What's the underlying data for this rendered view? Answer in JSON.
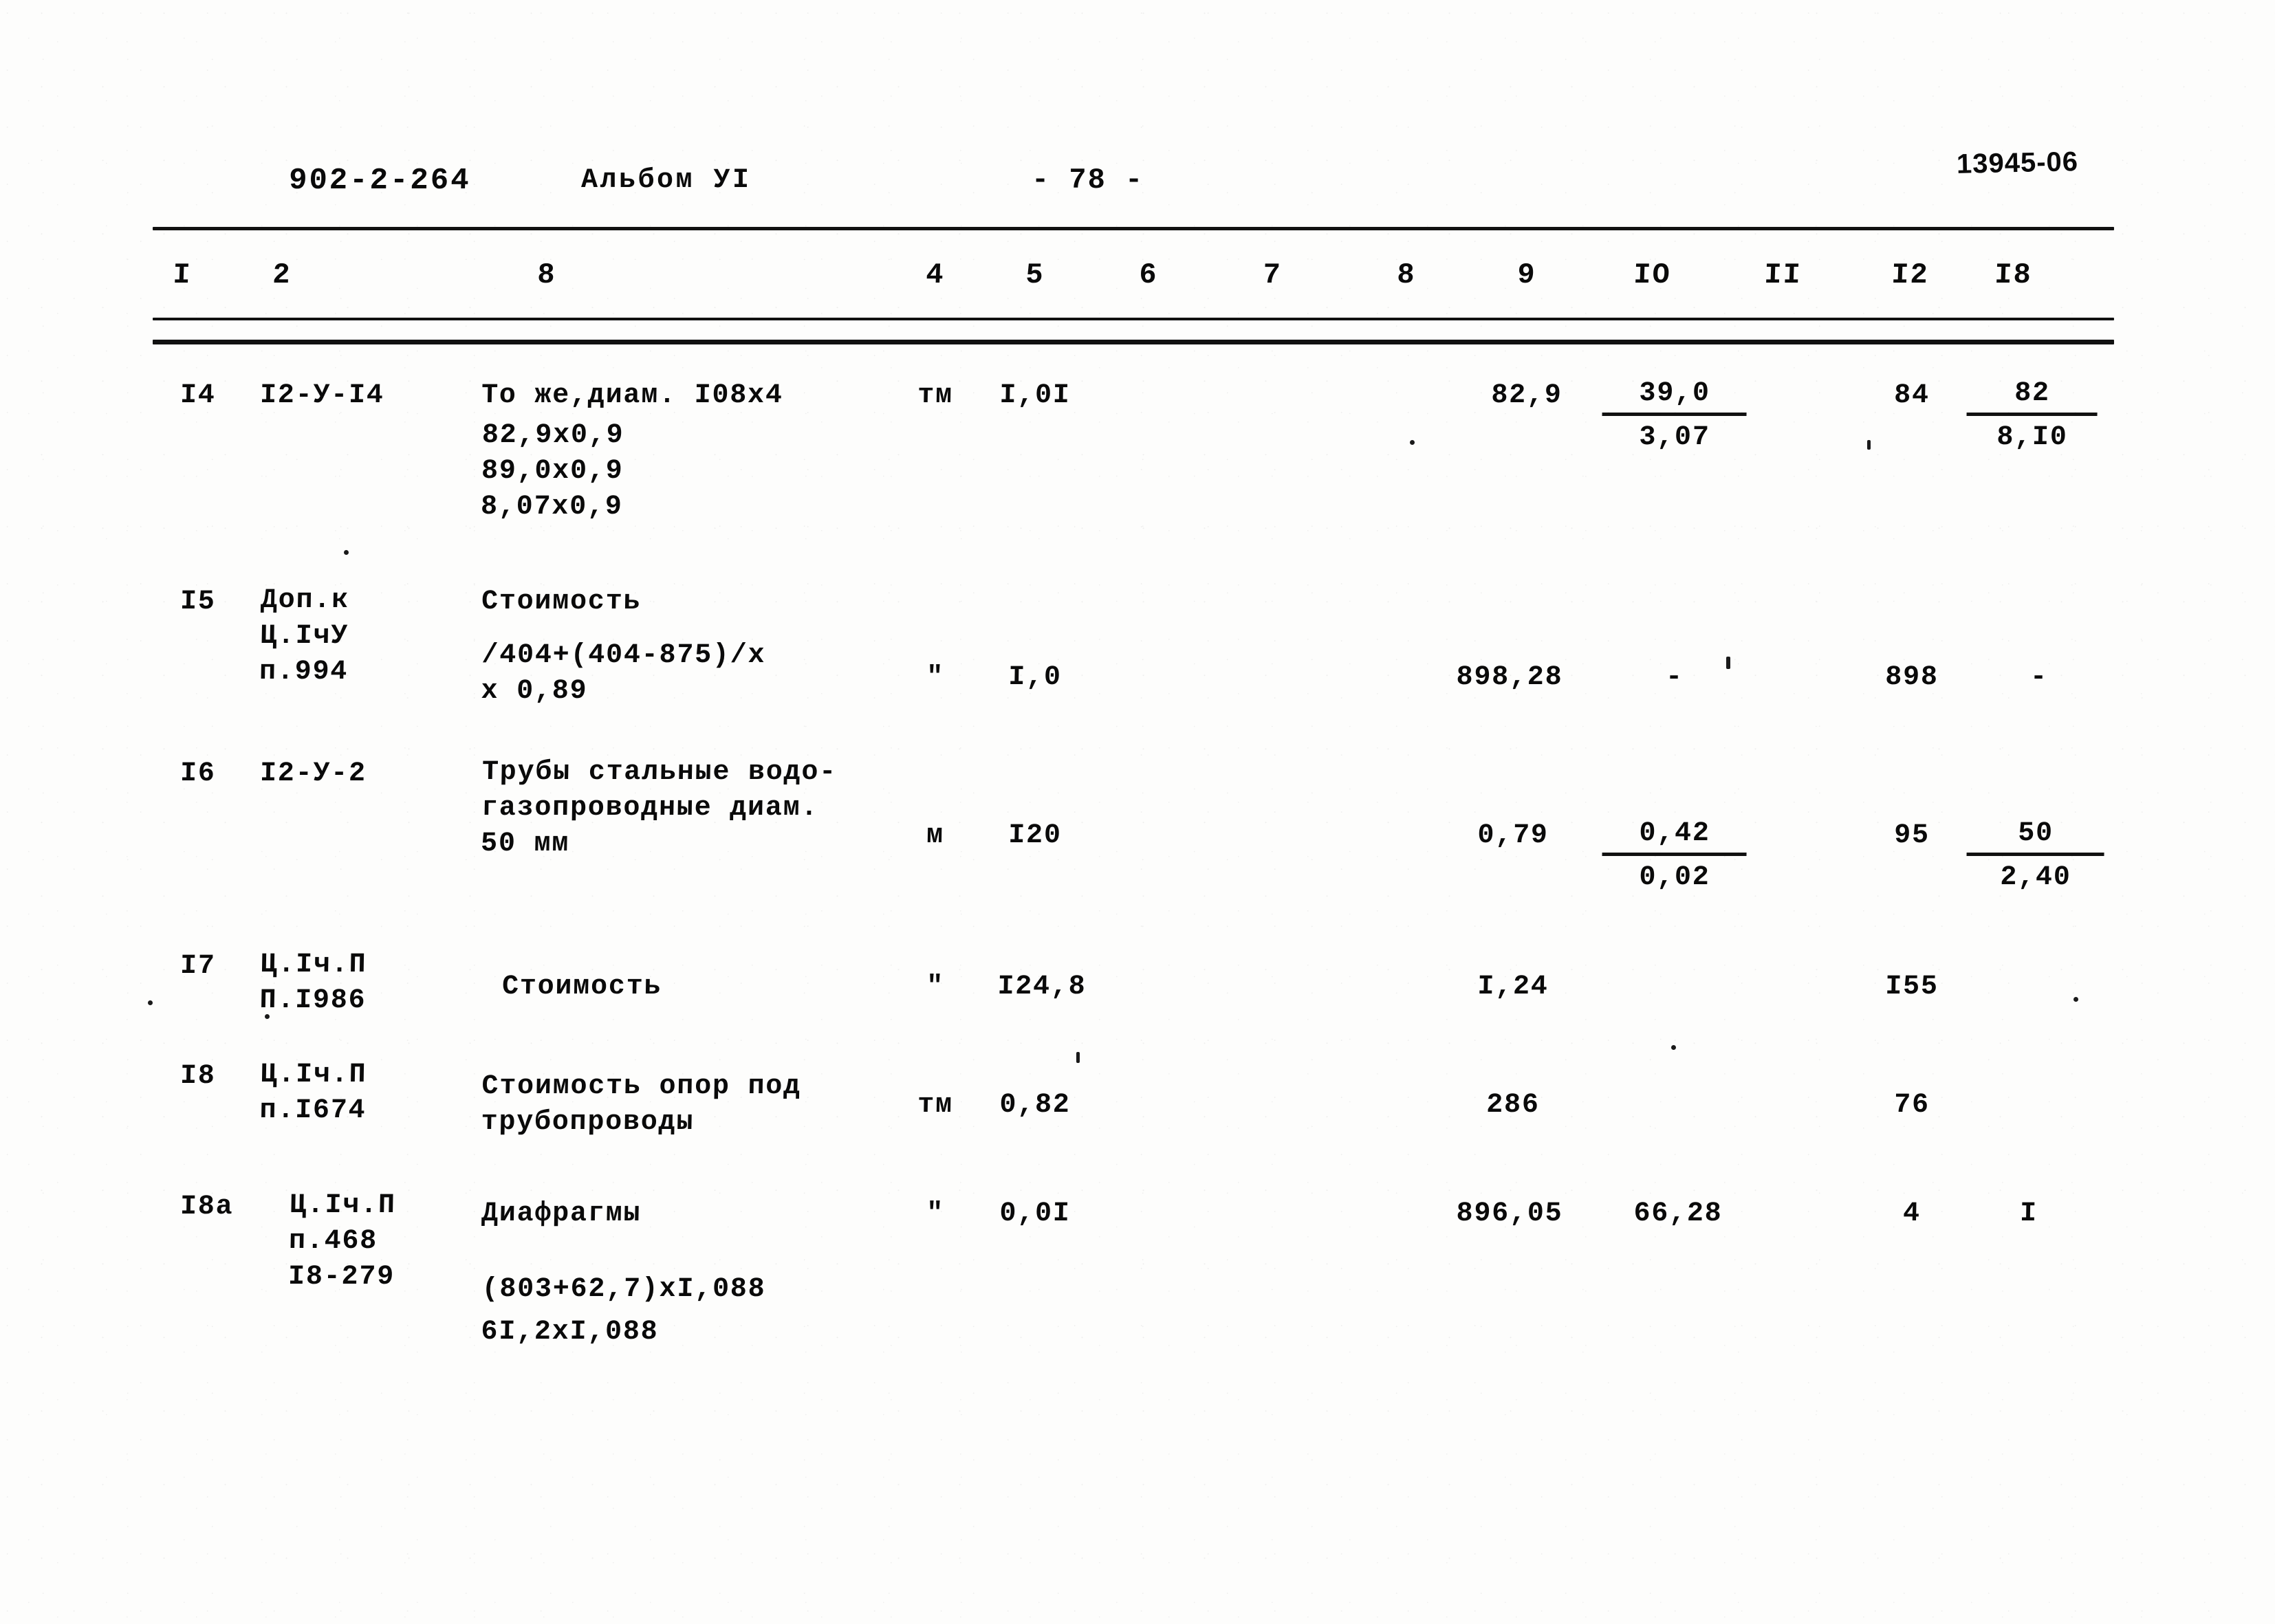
{
  "header": {
    "project_code": "902-2-264",
    "album": "Альбом УI",
    "page_number": "- 78 -",
    "archive_stamp": "13945-06"
  },
  "table": {
    "column_headers": [
      "I",
      "2",
      "8",
      "4",
      "5",
      "6",
      "7",
      "8",
      "9",
      "IO",
      "II",
      "I2",
      "I8"
    ],
    "rows": [
      {
        "no": "I4",
        "code": "I2-У-I4",
        "description": "То же,диам. I08х4",
        "description_lines": "82,9х0,9\n89,0х0,9\n8,07х0,9",
        "unit": "тм",
        "qty": "I,0I",
        "col6": "",
        "col7": "",
        "col8": "",
        "col9": "82,9",
        "col10_top": "39,0",
        "col10_bot": "3,07",
        "col11": "",
        "col12": "84",
        "col13_top": "82",
        "col13_bot": "8,I0"
      },
      {
        "no": "I5",
        "code": "Доп.к\nЦ.IчУ\nп.994",
        "description": "Стоимость",
        "description_lines": "/404+(404-875)/х\nх 0,89",
        "unit": "\"",
        "qty": "I,0",
        "col6": "",
        "col7": "",
        "col8": "",
        "col9": "898,28",
        "col10": "-",
        "col11": "",
        "col12": "898",
        "col13": "-"
      },
      {
        "no": "I6",
        "code": "I2-У-2",
        "description": "Трубы стальные водо-\nгазопроводные диам.\n50 мм",
        "description_lines": "",
        "unit": "м",
        "qty": "I20",
        "col6": "",
        "col7": "",
        "col8": "",
        "col9": "0,79",
        "col10_top": "0,42",
        "col10_bot": "0,02",
        "col11": "",
        "col12": "95",
        "col13_top": "50",
        "col13_bot": "2,40"
      },
      {
        "no": "I7",
        "code": "Ц.Iч.П\nП.I986",
        "description": "Стоимость",
        "description_lines": "",
        "unit": "\"",
        "qty": "I24,8",
        "col6": "",
        "col7": "",
        "col8": "",
        "col9": "I,24",
        "col10": "",
        "col11": "",
        "col12": "I55",
        "col13": ""
      },
      {
        "no": "I8",
        "code": "Ц.Iч.П\nп.I674",
        "description": "Стоимость опор под\nтрубопроводы",
        "description_lines": "",
        "unit": "тм",
        "qty": "0,82",
        "col6": "",
        "col7": "",
        "col8": "",
        "col9": "286",
        "col10": "",
        "col11": "",
        "col12": "76",
        "col13": ""
      },
      {
        "no": "I8a",
        "code": "Ц.Iч.П\nп.468\nI8-279",
        "description": "Диафрагмы",
        "description_lines": "(803+62,7)хI,088\n6I,2хI,088",
        "unit": "\"",
        "qty": "0,0I",
        "col6": "",
        "col7": "",
        "col8": "",
        "col9": "896,05",
        "col10": "66,28",
        "col11": "",
        "col12": "4",
        "col13": "I"
      }
    ]
  }
}
